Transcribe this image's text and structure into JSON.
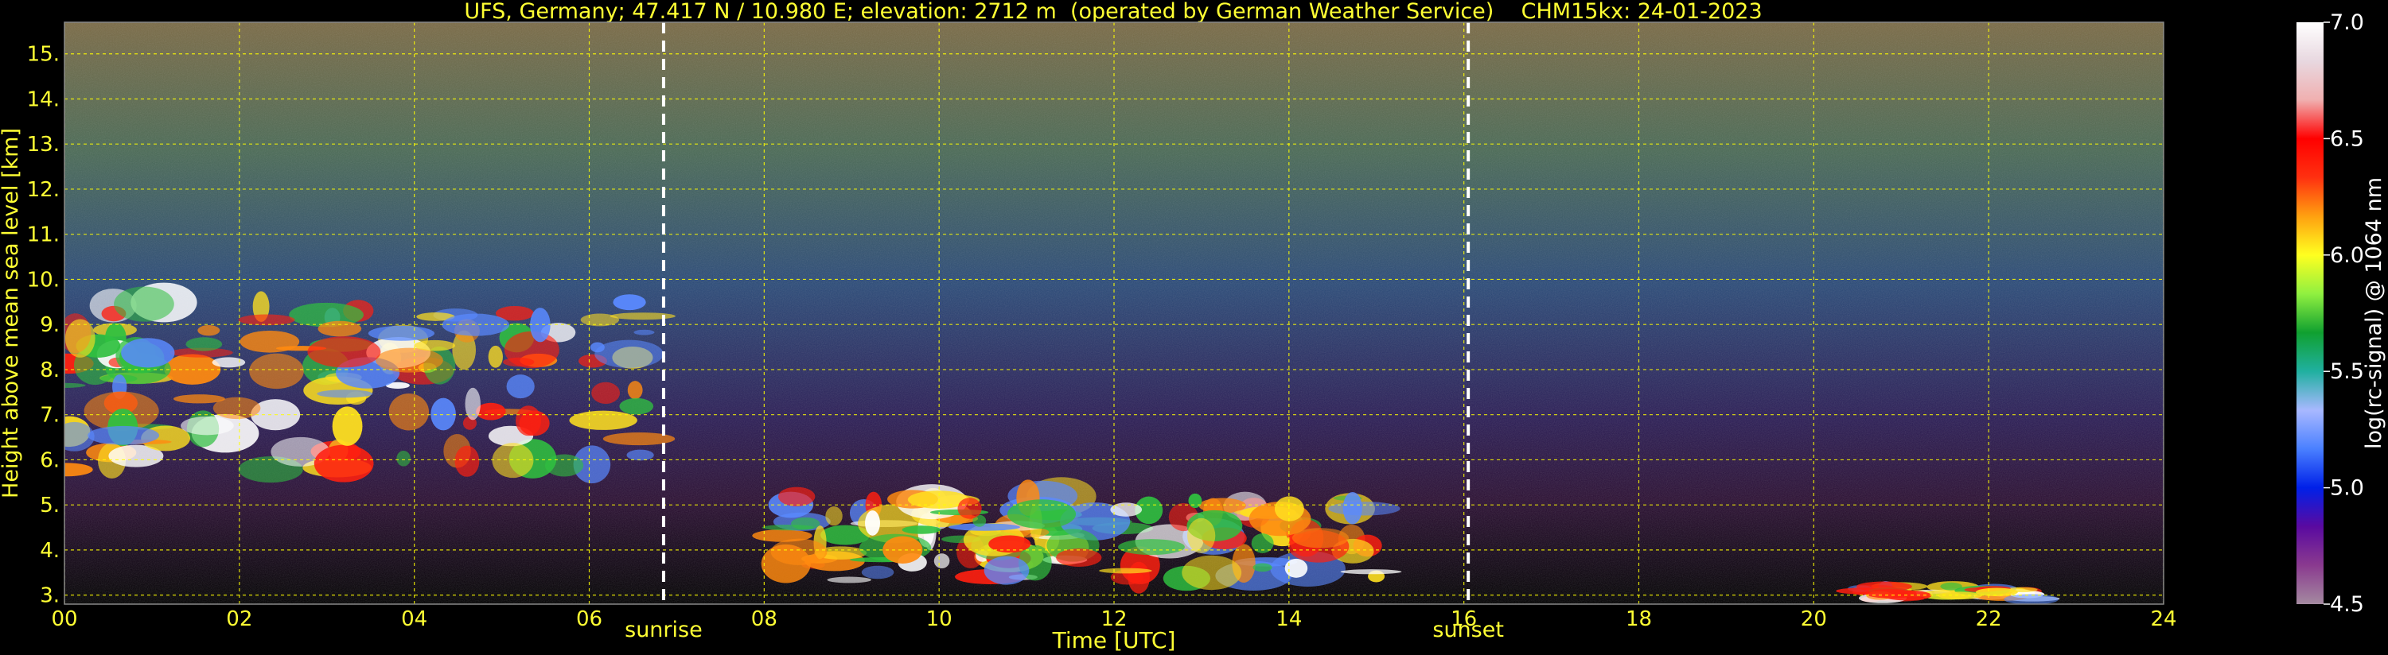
{
  "title": "UFS, Germany; 47.417 N / 10.980 E; elevation: 2712 m  (operated by German Weather Service)    CHM15kx: 24-01-2023",
  "colors": {
    "text": "#ffff33",
    "grid": "#ffff00",
    "background": "#000000",
    "marker": "#ffffff"
  },
  "chart_data": {
    "type": "heatmap",
    "xlabel": "Time [UTC]",
    "ylabel": "Height above mean sea level [km]",
    "xlim": [
      0,
      24
    ],
    "ylim": [
      2.8,
      15.7
    ],
    "x_ticks": [
      "00",
      "02",
      "04",
      "06",
      "08",
      "10",
      "12",
      "14",
      "16",
      "18",
      "20",
      "22",
      "24"
    ],
    "y_ticks": [
      "3.",
      "4.",
      "5.",
      "6.",
      "7.",
      "8.",
      "9.",
      "10.",
      "11.",
      "12.",
      "13.",
      "14.",
      "15."
    ],
    "grid": true,
    "markers": [
      {
        "label": "sunrise",
        "x": 6.85
      },
      {
        "label": "sunset",
        "x": 16.05
      }
    ],
    "colorbar": {
      "label": "log(rc-signal) @ 1064 nm",
      "range": [
        4.5,
        7.0
      ],
      "ticks": [
        "4.5",
        "5.0",
        "5.5",
        "6.0",
        "6.5",
        "7.0"
      ],
      "stops": [
        "#a48aa0",
        "#8a3a8f",
        "#5a0aa0",
        "#0020e8",
        "#4a80ff",
        "#a8b8ff",
        "#20b0a0",
        "#10a030",
        "#90f040",
        "#ffff20",
        "#ffa010",
        "#ff3010",
        "#ff0000",
        "#f0b0b0",
        "#e8d8e0",
        "#ffffff"
      ]
    },
    "layers": [
      {
        "name": "cloud-night",
        "x": [
          0.0,
          6.8
        ],
        "y": [
          5.7,
          9.5
        ]
      },
      {
        "name": "cloud-day",
        "x": [
          8.2,
          15.0
        ],
        "y": [
          3.3,
          5.2
        ]
      },
      {
        "name": "cloud-evening",
        "x": [
          20.5,
          22.5
        ],
        "y": [
          2.9,
          3.2
        ]
      }
    ]
  }
}
